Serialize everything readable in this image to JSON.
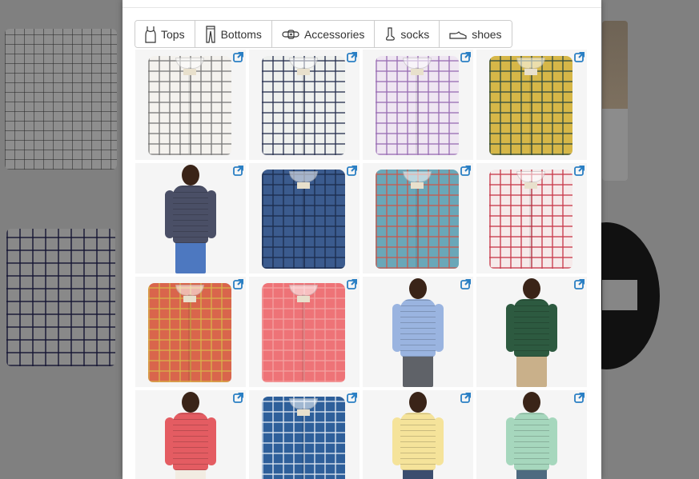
{
  "tabs": [
    {
      "label": "Tops",
      "icon": "tank-top-icon"
    },
    {
      "label": "Bottoms",
      "icon": "pants-icon"
    },
    {
      "label": "Accessories",
      "icon": "belt-icon"
    },
    {
      "label": "socks",
      "icon": "sock-icon"
    },
    {
      "label": "shoes",
      "icon": "shoe-icon"
    }
  ],
  "colors": {
    "link_icon": "#2a7fc4",
    "tab_border": "#cccccc",
    "backdrop": "#808080"
  },
  "products": [
    {
      "kind": "folded",
      "colors": [
        "#f4f2ee",
        "#7a7a7a"
      ]
    },
    {
      "kind": "folded",
      "colors": [
        "#eef0ee",
        "#27304f"
      ]
    },
    {
      "kind": "folded",
      "colors": [
        "#efe6f2",
        "#9a6fb4"
      ]
    },
    {
      "kind": "folded",
      "colors": [
        "#d6b748",
        "#304b3e"
      ]
    },
    {
      "kind": "model",
      "colors": [
        "#4a4f66",
        "#4d78c0"
      ]
    },
    {
      "kind": "folded",
      "colors": [
        "#3b5b8e",
        "#1c2c4d"
      ]
    },
    {
      "kind": "folded",
      "colors": [
        "#6aa7b8",
        "#c75a4f"
      ]
    },
    {
      "kind": "folded",
      "colors": [
        "#f6eaea",
        "#c8394a"
      ]
    },
    {
      "kind": "folded",
      "colors": [
        "#d9654c",
        "#d8b24a"
      ]
    },
    {
      "kind": "folded",
      "colors": [
        "#ee7377",
        "#f3a0a0"
      ]
    },
    {
      "kind": "model",
      "colors": [
        "#9ab4e0",
        "#5f6268"
      ]
    },
    {
      "kind": "model",
      "colors": [
        "#2d5a40",
        "#c9b08a"
      ]
    },
    {
      "kind": "model",
      "colors": [
        "#e45c62",
        "#f2ece2"
      ]
    },
    {
      "kind": "folded",
      "colors": [
        "#2e5f9a",
        "#dfe8f2"
      ]
    },
    {
      "kind": "model",
      "colors": [
        "#f5e39a",
        "#3b4d6e"
      ]
    },
    {
      "kind": "model",
      "colors": [
        "#a6d7bd",
        "#4e6a80"
      ]
    }
  ]
}
